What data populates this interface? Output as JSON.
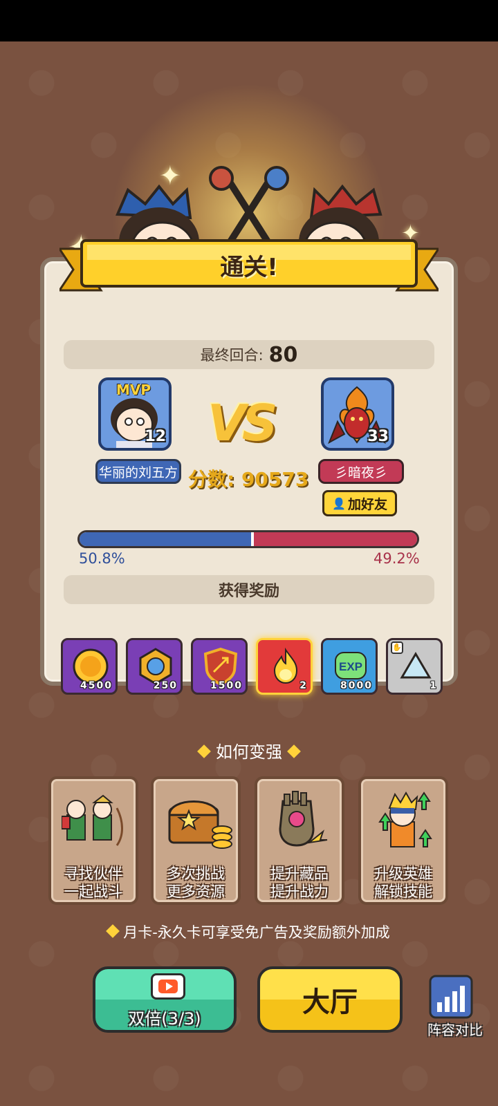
{
  "header": {
    "title": "通关!"
  },
  "round": {
    "label": "最终回合:",
    "value": "80"
  },
  "player": {
    "name": "华丽的刘五方",
    "badge": "MVP",
    "level": "12"
  },
  "vs_text": "VS",
  "score": {
    "label": "分数:",
    "value": "90573"
  },
  "opponent": {
    "name": "彡暗夜彡",
    "level": "33",
    "add_friend": "加好友"
  },
  "progress": {
    "left_pct_label": "50.8%",
    "right_pct_label": "49.2%",
    "left_fraction": 0.508,
    "left_color": "#3f67b5",
    "right_color": "#c23a56"
  },
  "rewards_title": "获得奖励",
  "rewards": [
    {
      "icon": "gold-coin-icon",
      "count": "4500"
    },
    {
      "icon": "medal-icon",
      "count": "250"
    },
    {
      "icon": "shield-bow-icon",
      "count": "1500"
    },
    {
      "icon": "fire-essence-icon",
      "count": "2"
    },
    {
      "icon": "exp-icon",
      "label": "EXP",
      "count": "8000"
    },
    {
      "icon": "triangle-crystal-icon",
      "count": "1"
    }
  ],
  "how_title": "如何变强",
  "tips": [
    {
      "icon": "partners-icon",
      "line1": "寻找伙伴",
      "line2": "一起战斗"
    },
    {
      "icon": "treasure-chest-icon",
      "line1": "多次挑战",
      "line2": "更多资源"
    },
    {
      "icon": "gauntlet-icon",
      "line1": "提升藏品",
      "line2": "提升战力"
    },
    {
      "icon": "hero-upgrade-icon",
      "line1": "升级英雄",
      "line2": "解锁技能"
    }
  ],
  "notice": "月卡-永久卡可享受免广告及奖励额外加成",
  "buttons": {
    "double": "双倍(3/3)",
    "lobby": "大厅",
    "compare": "阵容对比"
  }
}
